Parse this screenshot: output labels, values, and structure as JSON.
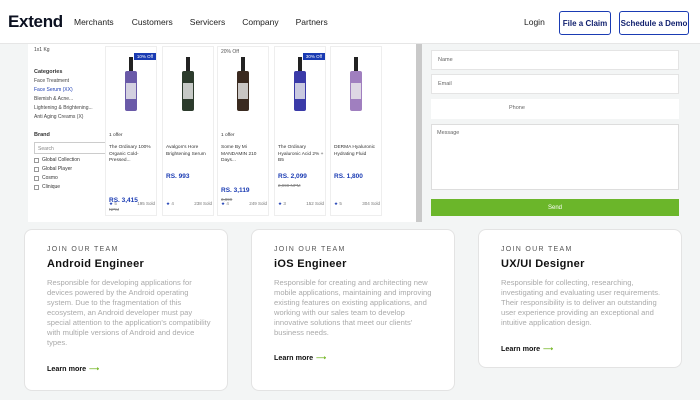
{
  "nav": {
    "logo": "Extend",
    "items": [
      "Merchants",
      "Customers",
      "Servicers",
      "Company",
      "Partners"
    ],
    "login": "Login",
    "file_claim": "File a Claim",
    "schedule_demo": "Schedule a Demo"
  },
  "shop": {
    "sidebar": {
      "top_text": "1x1 Kg",
      "categories_label": "Categories",
      "category_items": [
        "Face Treatment",
        "Face Serum (XX)",
        "Blemish & Acne...",
        "Lightening & Brightening...",
        "Anti Aging Creams (X)"
      ],
      "brand_label": "Brand",
      "search_placeholder": "Search",
      "brands": [
        "Global Collection",
        "Global Player",
        "Cosmo",
        "Clinique"
      ]
    },
    "products": [
      {
        "badge": "10% Off",
        "off": "",
        "offer": "1 offer",
        "name": "The Ordinary 100% Organic Cold-Pressed...",
        "price": "RS. 3,415",
        "old": "NPM",
        "sold": "195 Sold",
        "rating": "5",
        "color": "#6a5aa8"
      },
      {
        "badge": "",
        "off": "",
        "offer": "",
        "name": "Avalgon's Hore Brightening Serum",
        "price": "RS. 993",
        "old": "",
        "sold": "238 Sold",
        "rating": "4",
        "color": "#2c3b2c"
      },
      {
        "badge": "",
        "off": "20% Off",
        "offer": "1 offer",
        "name": "Some By Mi MANDAMIN 210 Days...",
        "price": "RS. 3,119",
        "old": "3,899",
        "sold": "249 Sold",
        "rating": "4",
        "color": "#3a2a20"
      },
      {
        "badge": "30% Off",
        "off": "",
        "offer": "",
        "name": "The Ordinary Hyaluronic Acid 2% + B5",
        "price": "RS. 2,099",
        "old": "2,999 NPM",
        "sold": "152 Sold",
        "rating": "3",
        "color": "#3a3aa8"
      },
      {
        "badge": "",
        "off": "",
        "offer": "",
        "name": "DERMA Hyaluronic Hydrating Fluid",
        "price": "RS. 1,800",
        "old": "",
        "sold": "304 Sold",
        "rating": "5",
        "color": "#a07fbf"
      }
    ]
  },
  "form": {
    "name_placeholder": "Name",
    "email_placeholder": "Email",
    "phone_placeholder": "Phone",
    "message_placeholder": "Message",
    "send_label": "Send"
  },
  "jobs": [
    {
      "eyebrow": "JOIN OUR TEAM",
      "title": "Android Engineer",
      "desc": "Responsible for developing applications for devices powered by the Android operating system. Due to the fragmentation of this ecosystem, an Android developer must pay special attention to the application's compatibility with multiple versions of Android and device types.",
      "more": "Learn more"
    },
    {
      "eyebrow": "JOIN OUR TEAM",
      "title": "iOS Engineer",
      "desc": "Responsible for creating and architecting new mobile applications, maintaining and improving existing features on existing applications, and working with our sales team to develop innovative solutions that meet our clients' business needs.",
      "more": "Learn more"
    },
    {
      "eyebrow": "JOIN OUR TEAM",
      "title": "UX/UI Designer",
      "desc": "Responsible for collecting, researching, investigating and evaluating user requirements. Their responsibility is to deliver an outstanding user experience providing an exceptional and intuitive application design.",
      "more": "Learn more"
    }
  ],
  "colors": {
    "brand_blue": "#1a3bb3",
    "send_green": "#6bb62a",
    "learn_arrow": "#78b82a"
  }
}
